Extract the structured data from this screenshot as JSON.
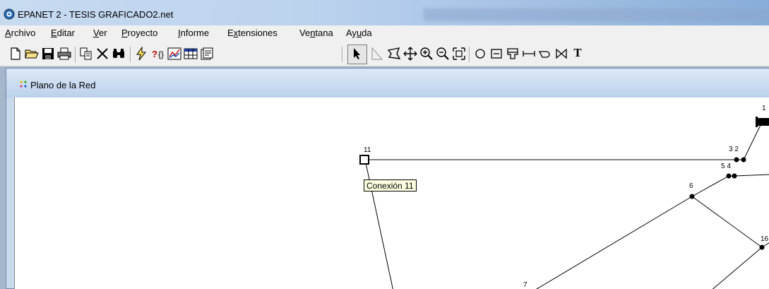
{
  "window": {
    "title": "EPANET 2 - TESIS GRAFICADO2.net"
  },
  "menu": [
    {
      "pre": "",
      "u": "A",
      "post": "rchivo"
    },
    {
      "pre": "",
      "u": "E",
      "post": "ditar"
    },
    {
      "pre": "",
      "u": "V",
      "post": "er"
    },
    {
      "pre": "",
      "u": "P",
      "post": "royecto"
    },
    {
      "pre": "",
      "u": "I",
      "post": "nforme"
    },
    {
      "pre": "E",
      "u": "x",
      "post": "tensiones"
    },
    {
      "pre": "Ve",
      "u": "n",
      "post": "tana"
    },
    {
      "pre": "Ay",
      "u": "u",
      "post": "da"
    }
  ],
  "toolbar": {
    "icons": [
      "new-file-icon",
      "open-folder-icon",
      "save-icon",
      "print-icon",
      "copy-icon",
      "delete-icon",
      "find-icon",
      "run-icon",
      "query-icon",
      "graph-icon",
      "table-icon",
      "options-icon",
      "select-arrow-icon",
      "select-vertex-icon",
      "select-region-icon",
      "pan-icon",
      "zoom-in-icon",
      "zoom-out-icon",
      "full-extent-icon",
      "add-junction-icon",
      "add-reservoir-icon",
      "add-tank-icon",
      "add-pipe-icon",
      "add-pump-icon",
      "add-valve-icon",
      "add-label-icon"
    ],
    "text_tool": "T"
  },
  "child_window": {
    "title": "Plano de la Red"
  },
  "network": {
    "tooltip": "Conexión 11",
    "node_labels": {
      "n11": "11",
      "n1": "1",
      "n32": "3 2",
      "n54": "5 4",
      "n6": "6",
      "n16": "16",
      "n7": "7"
    }
  },
  "colors": {
    "titlebar": "#bcd3ee",
    "canvas": "#ffffff",
    "tooltip_bg": "#ffffe1",
    "node": "#000000"
  }
}
